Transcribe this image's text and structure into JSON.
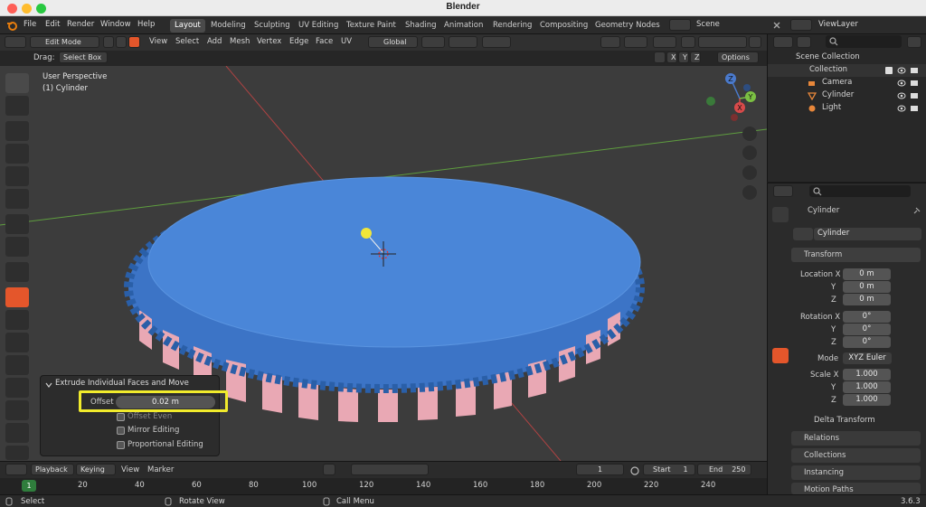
{
  "window_title": "Blender",
  "menus": [
    "File",
    "Edit",
    "Render",
    "Window",
    "Help"
  ],
  "workspaces": [
    "Layout",
    "Modeling",
    "Sculpting",
    "UV Editing",
    "Texture Paint",
    "Shading",
    "Animation",
    "Rendering",
    "Compositing",
    "Geometry Nodes"
  ],
  "active_workspace": "Layout",
  "scene": "Scene",
  "view_layer": "ViewLayer",
  "viewport_header": {
    "mode": "Edit Mode",
    "menus": [
      "View",
      "Select",
      "Add",
      "Mesh",
      "Vertex",
      "Edge",
      "Face",
      "UV"
    ],
    "transform_orientation": "Global",
    "drag_label": "Drag:",
    "drag_value": "Select Box",
    "axes": [
      "X",
      "Y",
      "Z"
    ],
    "options": "Options"
  },
  "viewport": {
    "perspective": "User Perspective",
    "object": "(1) Cylinder",
    "gizmo_labels": {
      "z": "Z",
      "y": "Y",
      "x": "X"
    },
    "colors": {
      "background": "#3c3c3c",
      "face": "#4a86d8",
      "face_dark": "#3c74c6",
      "selected_side": "#e9a8b4",
      "grid_red": "#b04343",
      "grid_green": "#5f9e3f",
      "light": "#f0e63a"
    }
  },
  "operator_panel": {
    "title": "Extrude Individual Faces and Move",
    "offset_label": "Offset",
    "offset_value": "0.02 m",
    "checkboxes": [
      "Offset Even",
      "Mirror Editing",
      "Proportional Editing"
    ]
  },
  "timeline": {
    "playback": "Playback",
    "keying": "Keying",
    "view": "View",
    "marker": "Marker",
    "current_frame": "1",
    "start_label": "Start",
    "start": "1",
    "end_label": "End",
    "end": "250",
    "ruler_current": "1",
    "ruler_ticks": [
      "20",
      "40",
      "60",
      "80",
      "100",
      "120",
      "140",
      "160",
      "180",
      "200",
      "220",
      "240"
    ]
  },
  "outliner": {
    "scene_collection": "Scene Collection",
    "collection": "Collection",
    "items": [
      "Camera",
      "Cylinder",
      "Light"
    ]
  },
  "properties": {
    "object_name": "Cylinder",
    "name_field": "Cylinder",
    "transform_label": "Transform",
    "location_label": "Location X",
    "rotation_label": "Rotation X",
    "scale_label": "Scale X",
    "axis_y": "Y",
    "axis_z": "Z",
    "location": [
      "0 m",
      "0 m",
      "0 m"
    ],
    "rotation": [
      "0°",
      "0°",
      "0°"
    ],
    "scale": [
      "1.000",
      "1.000",
      "1.000"
    ],
    "mode_label": "Mode",
    "mode_value": "XYZ Euler",
    "delta_transform": "Delta Transform",
    "panels": [
      "Relations",
      "Collections",
      "Instancing",
      "Motion Paths"
    ]
  },
  "status_bar": {
    "select": "Select",
    "rotate": "Rotate View",
    "call_menu": "Call Menu",
    "version": "3.6.3"
  }
}
